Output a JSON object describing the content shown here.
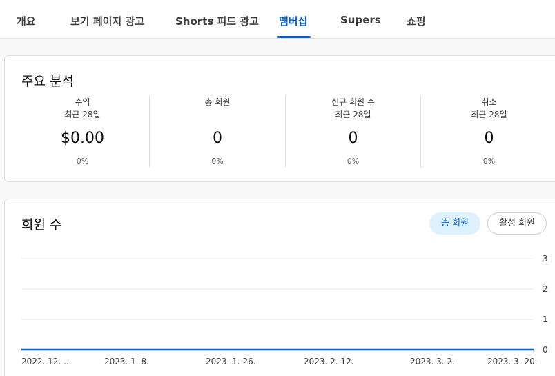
{
  "tabs": [
    {
      "label": "개요"
    },
    {
      "label": "보기 페이지 광고"
    },
    {
      "label": "Shorts 피드 광고"
    },
    {
      "label": "멤버십"
    },
    {
      "label": "Supers"
    },
    {
      "label": "쇼핑"
    }
  ],
  "active_tab": "멤버십",
  "colors": {
    "accent": "#065fd4",
    "chip_selected_bg": "#def1ff",
    "line": "#065fd4"
  },
  "key_metrics": {
    "title": "주요 분석",
    "items": [
      {
        "label": "수익",
        "sub": "최근 28일",
        "value": "$0.00",
        "change": "0%"
      },
      {
        "label": "총 회원",
        "sub": "",
        "value": "0",
        "change": "0%"
      },
      {
        "label": "신규 회원 수",
        "sub": "최근 28일",
        "value": "0",
        "change": "0%"
      },
      {
        "label": "취소",
        "sub": "최근 28일",
        "value": "0",
        "change": "0%"
      }
    ]
  },
  "members_chart": {
    "title": "회원 수",
    "chips": [
      {
        "label": "총 회원",
        "selected": true
      },
      {
        "label": "활성 회원",
        "selected": false
      }
    ]
  },
  "chart_data": {
    "type": "line",
    "x": [
      "2022. 12. ...",
      "2023. 1. 8.",
      "2023. 1. 26.",
      "2023. 2. 12.",
      "2023. 3. 2.",
      "2023. 3. 20."
    ],
    "series": [
      {
        "values": [
          0,
          0,
          0,
          0,
          0,
          0
        ]
      }
    ],
    "y_ticks": [
      "0",
      "1",
      "2",
      "3"
    ],
    "ylim": [
      0,
      3
    ],
    "grid": true
  }
}
